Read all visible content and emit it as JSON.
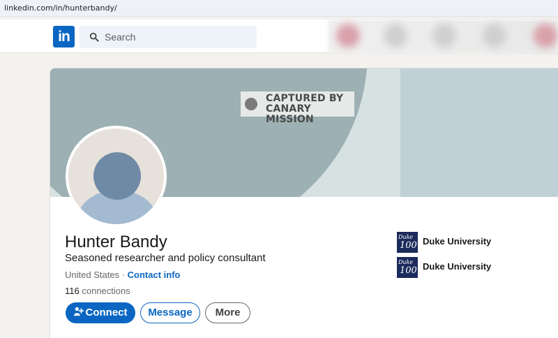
{
  "browser": {
    "url": "linkedin.com/in/hunterbandy/"
  },
  "nav": {
    "logo_text": "in",
    "search_placeholder": "Search"
  },
  "banner": {
    "watermark_line1": "CAPTURED BY",
    "watermark_line2": "CANARY MISSION"
  },
  "profile": {
    "name": "Hunter Bandy",
    "headline": "Seasoned researcher and policy consultant",
    "location": "United States",
    "separator": "·",
    "contact_info": "Contact info",
    "connections_count": "116",
    "connections_label": "connections"
  },
  "actions": {
    "connect": "Connect",
    "message": "Message",
    "more": "More"
  },
  "education": [
    {
      "name": "Duke University",
      "logo_line1": "Duke",
      "logo_line2": "100"
    },
    {
      "name": "Duke University",
      "logo_line1": "Duke",
      "logo_line2": "100"
    }
  ],
  "colors": {
    "brand": "#0a66c2",
    "banner_dark": "#9db0b3",
    "banner_light": "#bfd1d6",
    "duke_navy": "#1b2b5c"
  }
}
